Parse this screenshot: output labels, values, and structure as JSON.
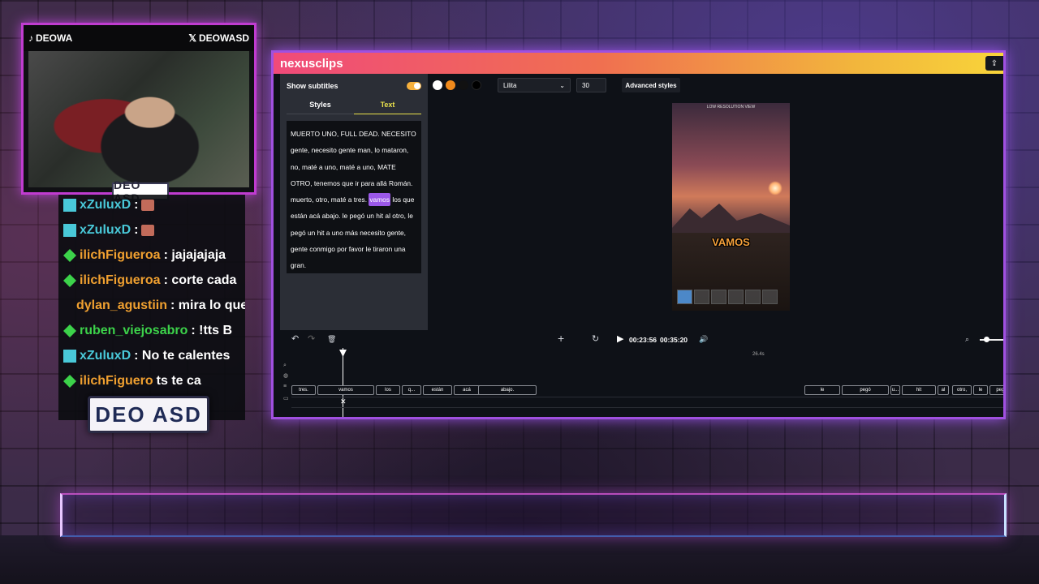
{
  "webcam": {
    "tiktok_handle": "DEOWA",
    "x_handle": "DEOWASD",
    "logo": "DEO ASD"
  },
  "chat": {
    "messages": [
      {
        "user": "xZuluxD",
        "user_color": "#49c8d8",
        "badge": "grid",
        "text": ":",
        "emote": true
      },
      {
        "user": "xZuluxD",
        "user_color": "#49c8d8",
        "badge": "grid",
        "text": ":",
        "emote": true
      },
      {
        "user": "ilichFigueroa",
        "user_color": "#f0a030",
        "badge": "diamond",
        "text": ": jajajajaja"
      },
      {
        "user": "ilichFigueroa",
        "user_color": "#f0a030",
        "badge": "diamond",
        "text": ": corte cada"
      },
      {
        "user": "dylan_agustiin",
        "user_color": "#f0a030",
        "badge": "",
        "text": ": mira lo que"
      },
      {
        "user": "ruben_viejosabro",
        "user_color": "#3cd24a",
        "badge": "diamond",
        "text": ": !tts B"
      },
      {
        "user": "xZuluxD",
        "user_color": "#49c8d8",
        "badge": "grid",
        "text": ": No te calentes"
      },
      {
        "user": "ilichFiguero",
        "user_color": "#f0a030",
        "badge": "diamond",
        "text": "ts te ca"
      }
    ],
    "overlay_logo": "DEO ASD"
  },
  "app": {
    "title": "nexusclips",
    "share_icon": "share-icon",
    "left_panel": {
      "show_subtitles_label": "Show subtitles",
      "show_subtitles_on": true,
      "tab_styles": "Styles",
      "tab_text": "Text",
      "text_before": "MUERTO UNO, FULL DEAD. NECESITO gente, necesito gente man, lo mataron, no, maté a uno, maté a uno, MATE OTRO, tenemos que ir para allá Román. muerto, otro, maté a tres. ",
      "text_highlight": "vamos",
      "text_after": " los que están acá abajo. le pegó un hit al otro, le pegó un hit a uno más necesito gente, gente conmigo por favor le tiraron una gran."
    },
    "toolbar": {
      "swatches": [
        "#ffffff",
        "#f08a1c",
        "#111111",
        "#000000"
      ],
      "font": "Lilita",
      "font_size": "30",
      "advanced_styles": "Advanced styles"
    },
    "preview": {
      "hud_text": "LOW RESOLUTION VIEW",
      "subtitle": "VAMOS"
    },
    "playback": {
      "current_time": "00:23:56",
      "total_time": "00:35:20"
    },
    "timeline": {
      "duration_label": "26.4s",
      "clips_left": [
        {
          "label": "tres."
        },
        {
          "label": "vamos"
        },
        {
          "label": "los"
        },
        {
          "label": "q..."
        },
        {
          "label": "están"
        },
        {
          "label": "acá"
        },
        {
          "label": "abajo."
        }
      ],
      "clips_right": [
        {
          "label": "le"
        },
        {
          "label": "pegó"
        },
        {
          "label": "u..."
        },
        {
          "label": "hit"
        },
        {
          "label": "al"
        },
        {
          "label": "otro,"
        },
        {
          "label": "le"
        },
        {
          "label": "pegó"
        }
      ]
    }
  }
}
